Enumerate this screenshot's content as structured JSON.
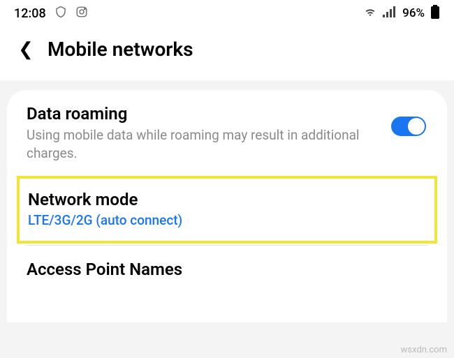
{
  "statusBar": {
    "time": "12:08",
    "batteryPercent": "96%"
  },
  "header": {
    "title": "Mobile networks"
  },
  "settings": {
    "dataRoaming": {
      "title": "Data roaming",
      "desc": "Using mobile data while roaming may result in additional charges.",
      "enabled": true
    },
    "networkMode": {
      "title": "Network mode",
      "value": "LTE/3G/2G (auto connect)"
    },
    "apn": {
      "title": "Access Point Names"
    }
  },
  "watermark": "wsxdn.com"
}
